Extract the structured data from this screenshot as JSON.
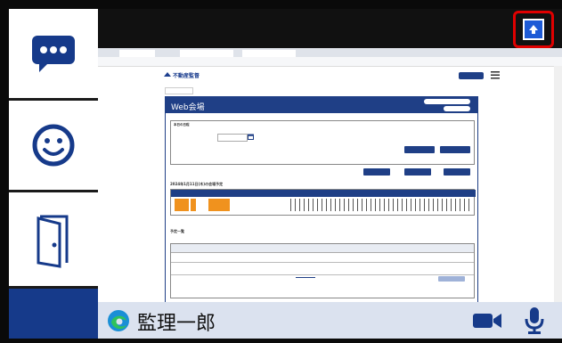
{
  "sidebar": {
    "chat_icon": "chat-bubble-icon",
    "face_icon": "smiley-face-icon",
    "exit_icon": "door-exit-icon"
  },
  "topbar": {
    "share_icon": "upload-arrow-icon"
  },
  "shared_page": {
    "logo": "不動産監督",
    "logo_sub": "",
    "panel_title": "Web会場",
    "section_today": "本日の日程",
    "timeline_title": "2024年1月11日(木)の会場予定",
    "pending_title": "予定一覧"
  },
  "footer": {
    "username": "監理一郎",
    "edge_icon": "edge-browser-icon",
    "camera_icon": "video-camera-icon",
    "mic_icon": "microphone-icon"
  },
  "colors": {
    "accent": "#1f3f86",
    "highlight": "#e00000",
    "sidebar_bottom": "#163a8a",
    "footer_bg": "#dbe2ef"
  }
}
